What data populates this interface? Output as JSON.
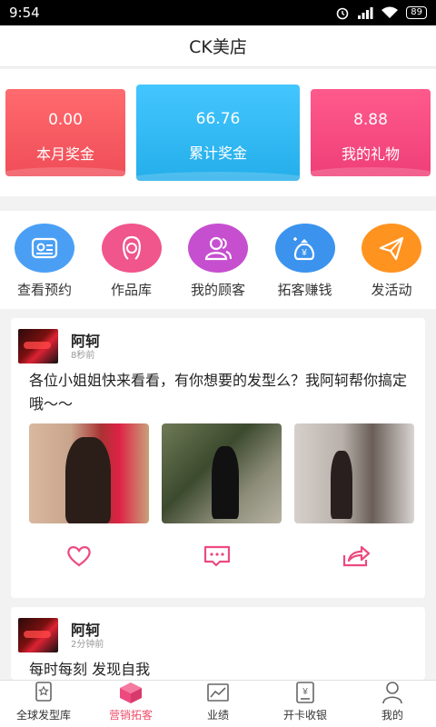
{
  "status": {
    "time": "9:54",
    "battery": "89"
  },
  "header": {
    "title": "CK美店"
  },
  "stats": [
    {
      "value": "0.00",
      "label": "本月奖金",
      "color": "#f04d58"
    },
    {
      "value": "66.76",
      "label": "累计奖金",
      "color": "#24aeea"
    },
    {
      "value": "8.88",
      "label": "我的礼物",
      "color": "#ef3f78"
    }
  ],
  "menu": [
    {
      "label": "查看预约",
      "icon": "id-card-icon",
      "color": "#4a9ff5"
    },
    {
      "label": "作品库",
      "icon": "hairstyle-icon",
      "color": "#f0558c"
    },
    {
      "label": "我的顾客",
      "icon": "users-icon",
      "color": "#c64fd0"
    },
    {
      "label": "拓客赚钱",
      "icon": "money-bag-icon",
      "color": "#3b93ee"
    },
    {
      "label": "发活动",
      "icon": "paper-plane-icon",
      "color": "#ff9320"
    }
  ],
  "posts": [
    {
      "name": "阿轲",
      "time": "8秒前",
      "text": "各位小姐姐快来看看，有你想要的发型么？我阿轲帮你搞定哦～～"
    },
    {
      "name": "阿轲",
      "time": "2分钟前",
      "text": "每时每刻 发现自我"
    }
  ],
  "tabs": [
    {
      "label": "全球发型库",
      "icon": "hairstyle-library-icon"
    },
    {
      "label": "营销拓客",
      "icon": "gift-box-icon"
    },
    {
      "label": "业绩",
      "icon": "chart-icon"
    },
    {
      "label": "开卡收银",
      "icon": "cashier-icon"
    },
    {
      "label": "我的",
      "icon": "profile-icon"
    }
  ],
  "colors": {
    "accent": "#f04d6a"
  }
}
